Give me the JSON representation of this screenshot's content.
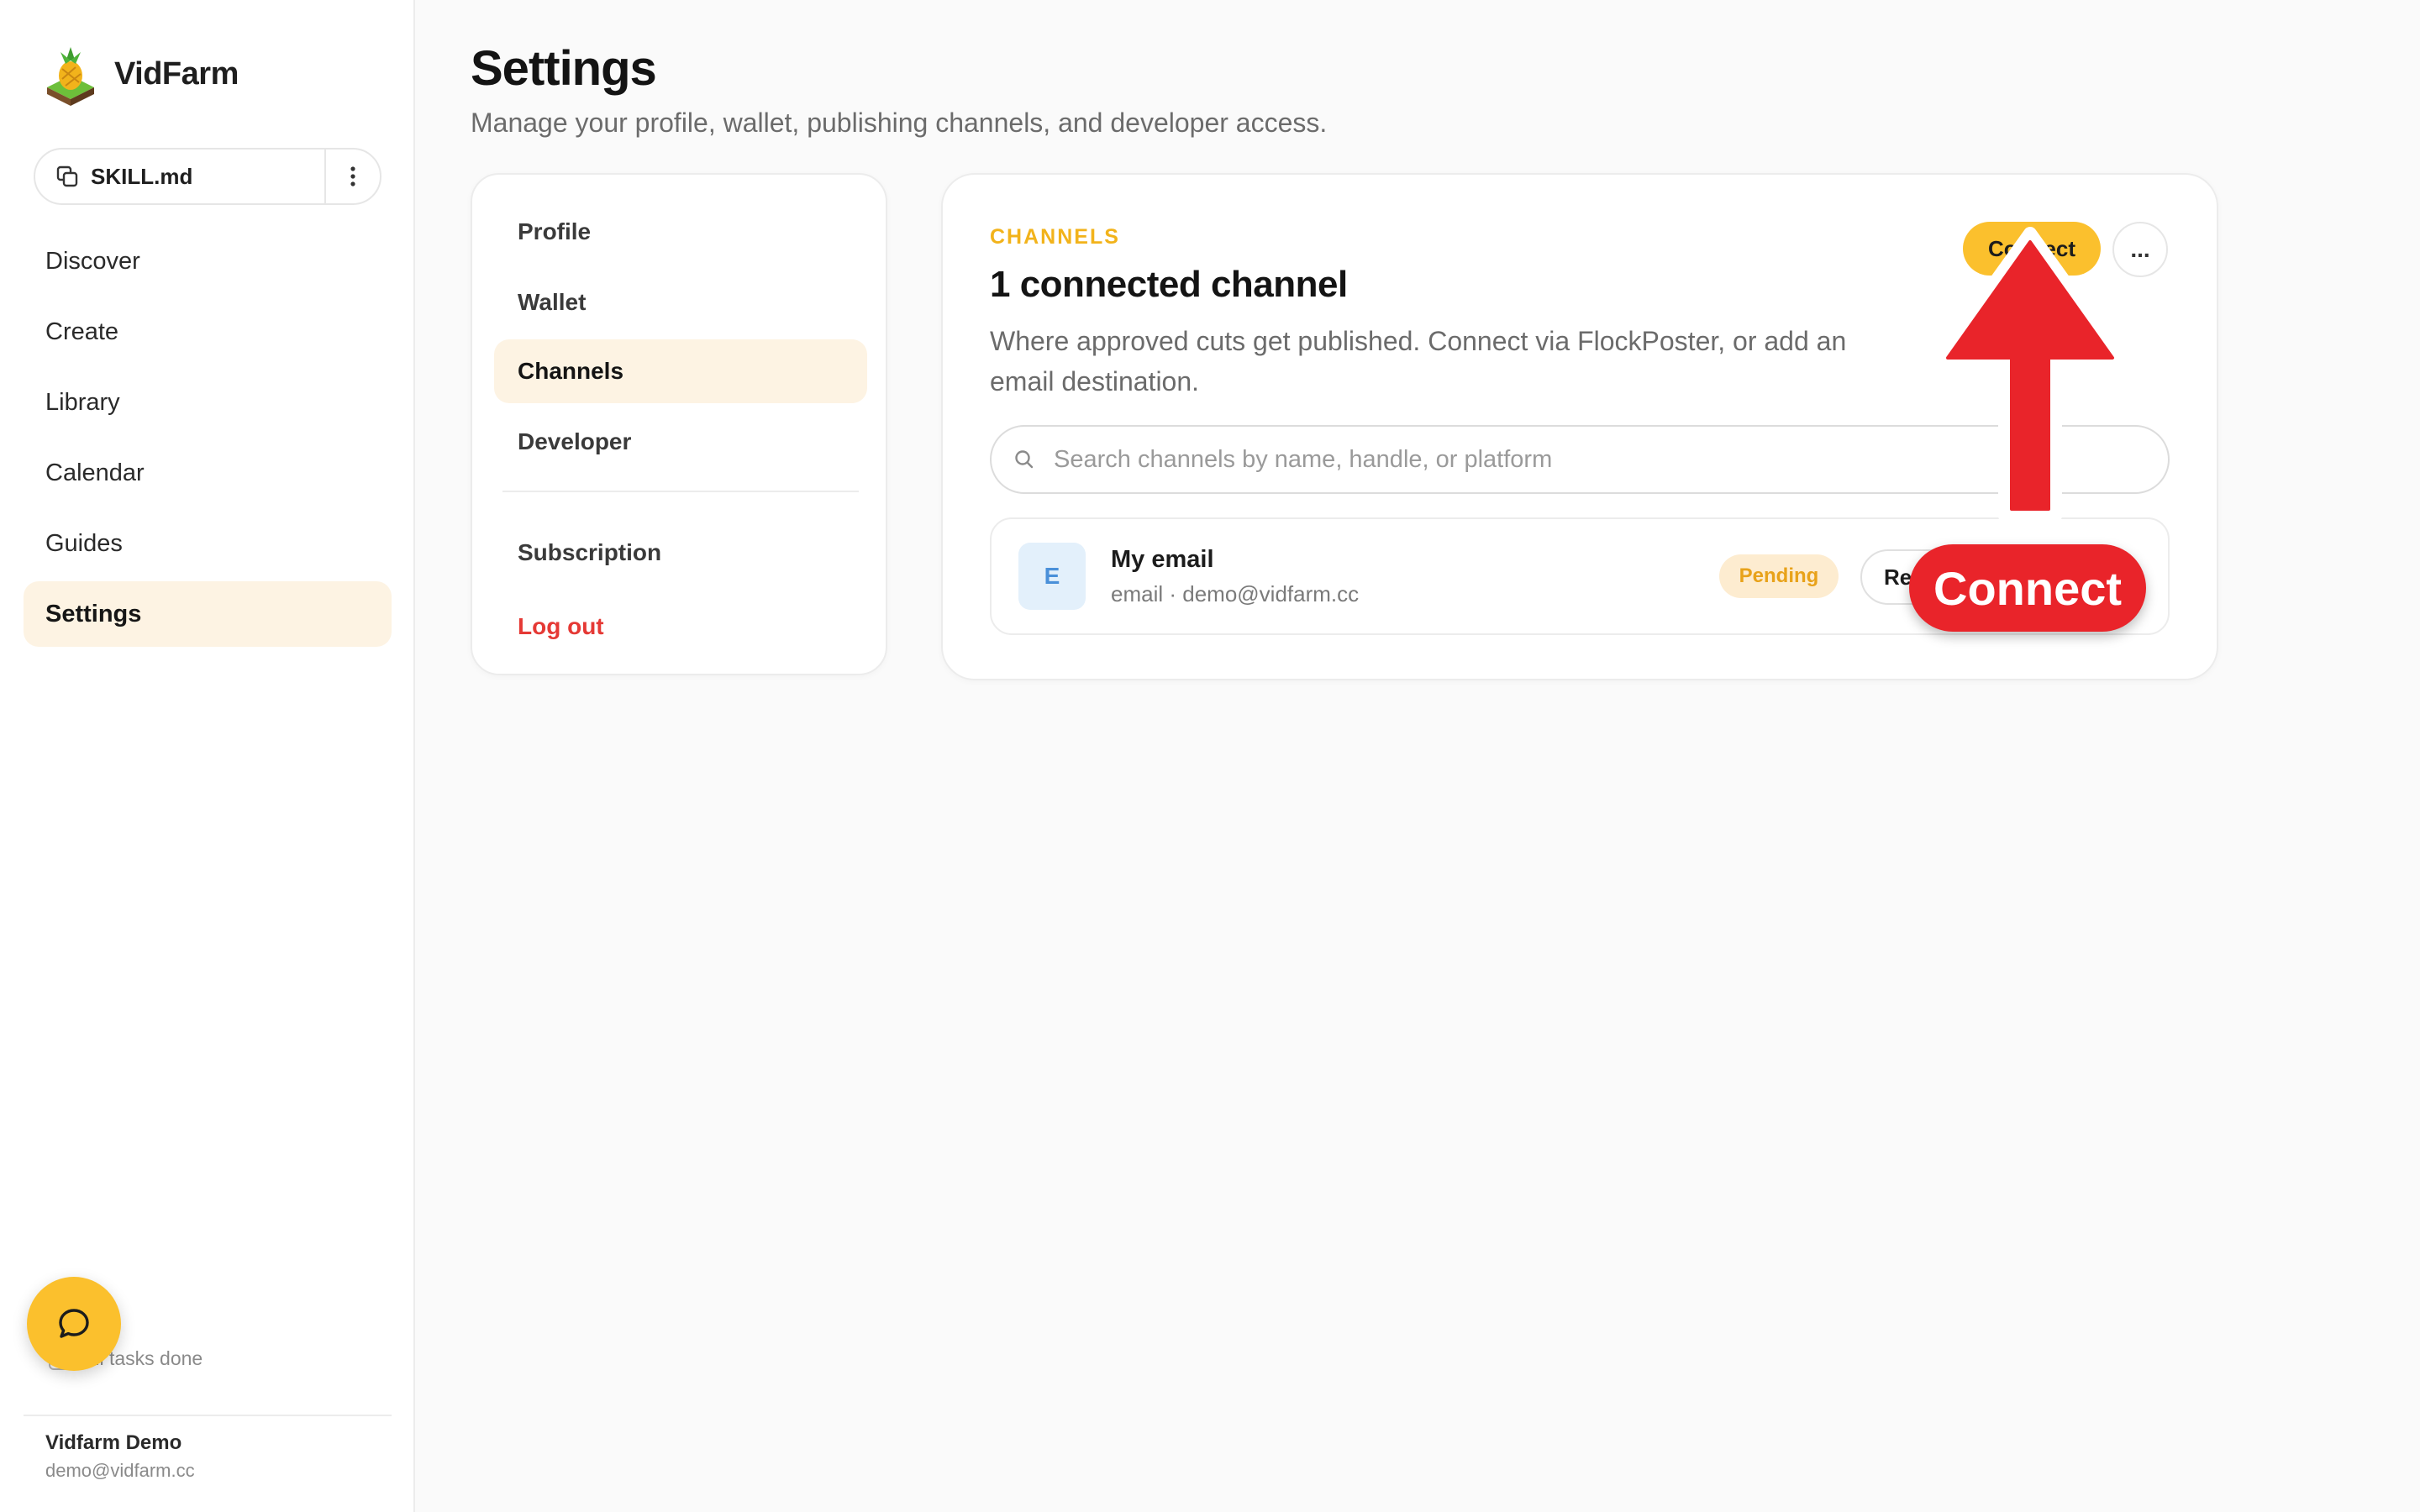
{
  "app": {
    "name": "VidFarm",
    "skill_file": "SKILL.md"
  },
  "nav": {
    "items": [
      {
        "label": "Discover"
      },
      {
        "label": "Create"
      },
      {
        "label": "Library"
      },
      {
        "label": "Calendar"
      },
      {
        "label": "Guides"
      },
      {
        "label": "Settings",
        "active": true
      }
    ]
  },
  "sidebar_footer": {
    "tasks_status": "All tasks done",
    "user_name": "Vidfarm Demo",
    "user_email": "demo@vidfarm.cc"
  },
  "page": {
    "title": "Settings",
    "subtitle": "Manage your profile, wallet, publishing channels, and developer access."
  },
  "settings_nav": {
    "items": [
      {
        "label": "Profile"
      },
      {
        "label": "Wallet"
      },
      {
        "label": "Channels",
        "active": true
      },
      {
        "label": "Developer"
      },
      {
        "label": "Subscription"
      },
      {
        "label": "Log out",
        "danger": true
      }
    ]
  },
  "channels": {
    "eyebrow": "CHANNELS",
    "title": "1 connected channel",
    "description": "Where approved cuts get published. Connect via FlockPoster, or add an email destination.",
    "connect_label": "Connect",
    "more_label": "...",
    "search_placeholder": "Search channels by name, handle, or platform",
    "search_value": "",
    "rows": [
      {
        "avatar_letter": "E",
        "name": "My email",
        "meta": "email · demo@vidfarm.cc",
        "status": "Pending",
        "action_label": "Resend"
      }
    ]
  },
  "annotation": {
    "label": "Connect",
    "icon": "arrow-up-icon"
  },
  "colors": {
    "accent": "#fbc02d",
    "active_bg": "#fdf3e3",
    "danger": "#e53935",
    "annotation_red": "#e9242a",
    "eyebrow": "#f2b31b",
    "pending_bg": "#fdecd0",
    "pending_text": "#e8a21a"
  },
  "icons": {
    "logo": "pineapple-logo-icon",
    "skill": "copy-icon",
    "skill_more": "vertical-dots-icon",
    "chat": "chat-bubble-icon",
    "tasks": "checkbox-icon",
    "search": "search-icon"
  }
}
